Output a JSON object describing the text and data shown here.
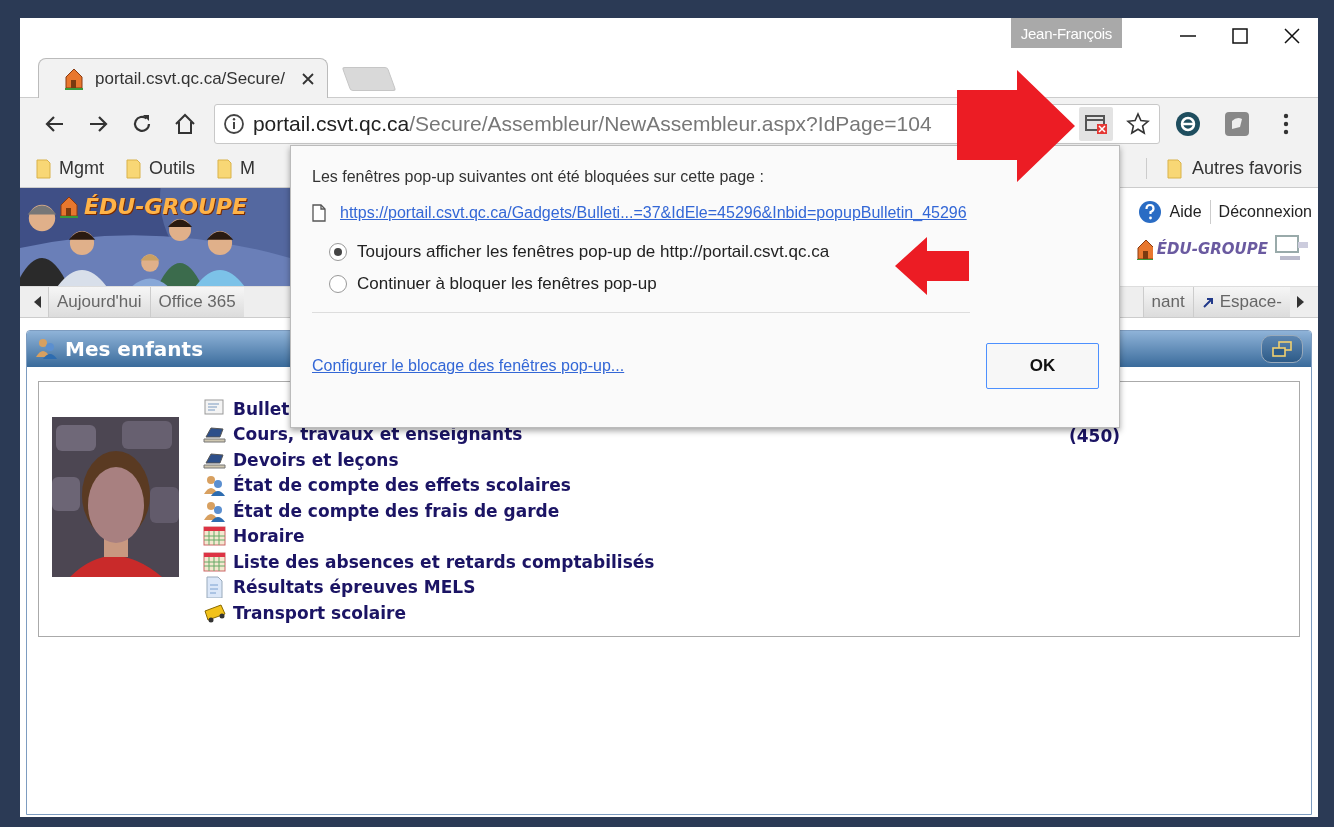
{
  "browser": {
    "profile": "Jean-François",
    "tab": {
      "title": "portail.csvt.qc.ca/Secure/"
    },
    "address": {
      "host": "portail.csvt.qc.ca",
      "path": "/Secure/Assembleur/NewAssembleur.aspx?IdPage=104"
    },
    "bookmarks": [
      {
        "label": "Mgmt"
      },
      {
        "label": "Outils"
      },
      {
        "label": "M"
      }
    ],
    "other_bookmarks": "Autres favoris"
  },
  "site": {
    "banner_logo": "ÉDU-GROUPE",
    "links": [
      "Aide",
      "Déconnexion"
    ],
    "small_logo": "ÉDU-GROUPE",
    "nav_left": [
      "Aujourd'hui",
      "Office 365"
    ],
    "nav_right": [
      {
        "label": "nant",
        "kind": "plain"
      },
      {
        "label": "Espace-",
        "kind": "shortcut"
      }
    ]
  },
  "panel": {
    "title": "Mes enfants",
    "links": [
      {
        "label": "Bullet",
        "kind": "report"
      },
      {
        "label": "Cours, travaux et enseignants",
        "kind": "books"
      },
      {
        "label": "Devoirs et leçons",
        "kind": "books"
      },
      {
        "label": "État de compte des effets scolaires",
        "kind": "people"
      },
      {
        "label": "État de compte des frais de garde",
        "kind": "people"
      },
      {
        "label": "Horaire",
        "kind": "calendar"
      },
      {
        "label": "Liste des absences et retards comptabilisés",
        "kind": "calendar"
      },
      {
        "label": "Résultats épreuves MELS",
        "kind": "document"
      },
      {
        "label": "Transport scolaire",
        "kind": "bus"
      }
    ],
    "side_note": "(450)"
  },
  "popup": {
    "message": "Les fenêtres pop-up suivantes ont été bloquées sur cette page :",
    "blocked_link": "https://portail.csvt.qc.ca/Gadgets/Bulleti...=37&IdEle=45296&Inbid=popupBulletin_45296",
    "options": [
      {
        "label": "Toujours afficher les fenêtres pop-up de http://portail.csvt.qc.ca",
        "selected": true
      },
      {
        "label": "Continuer à bloquer les fenêtres pop-up",
        "selected": false
      }
    ],
    "settings_link": "Configurer le blocage des fenêtres pop-up...",
    "ok_button": "OK"
  }
}
